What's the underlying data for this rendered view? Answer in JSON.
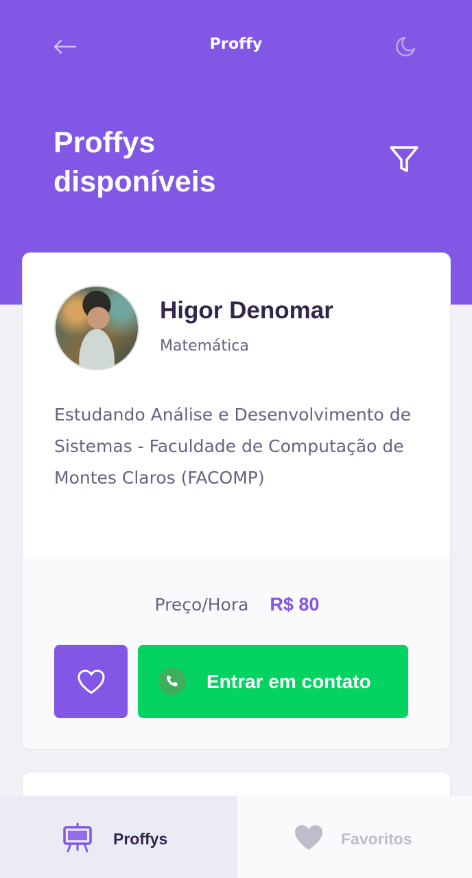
{
  "header": {
    "logo": "Proffy",
    "title": "Proffys disponíveis",
    "back_icon": "arrow-left-icon",
    "theme_icon": "moon-icon",
    "filter_icon": "filter-icon"
  },
  "teacher_card": {
    "name": "Higor Denomar",
    "subject": "Matemática",
    "bio": "Estudando Análise e Desenvolvimento de Sistemas - Faculdade de Computação de Montes Claros (FACOMP)",
    "price_label": "Preço/Hora",
    "price_value": "R$ 80",
    "favorite_icon": "heart-outline-icon",
    "contact_label": "Entrar em contato",
    "contact_icon": "whatsapp-icon"
  },
  "bottom_nav": {
    "tabs": [
      {
        "label": "Proffys",
        "icon": "easel-icon",
        "active": true
      },
      {
        "label": "Favoritos",
        "icon": "heart-icon",
        "active": false
      }
    ]
  },
  "colors": {
    "primary": "#8257E5",
    "whatsapp_green": "#04D361",
    "background": "#F0F0F7",
    "title_text": "#32264D",
    "body_text": "#6A6180"
  }
}
